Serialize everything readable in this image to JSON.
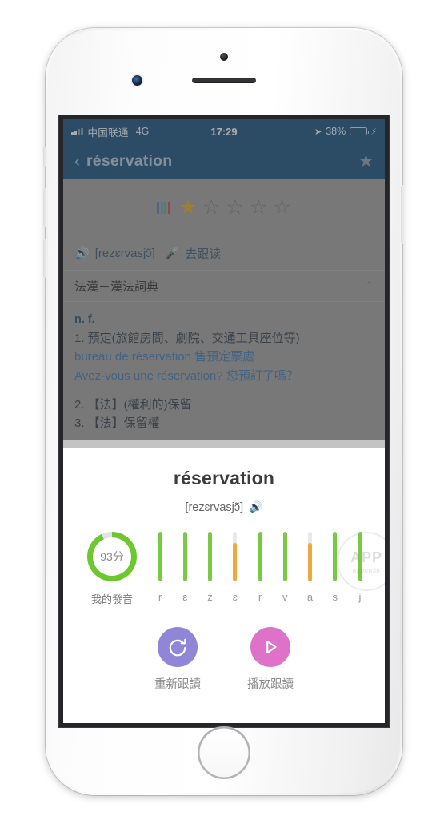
{
  "status_bar": {
    "carrier": "中国联通",
    "network": "4G",
    "time": "17:29",
    "battery_percent": "38%",
    "battery_level": 38,
    "location_icon": "location-arrow-icon",
    "charging_icon": "charging-bolt-icon"
  },
  "nav_bar": {
    "back_icon": "chevron-left-icon",
    "title": "réservation",
    "favorite_icon": "star-filled-icon"
  },
  "rating": {
    "books_icon": "books-icon",
    "stars_total": 5,
    "stars_filled": 1,
    "filled_color": "#c99524",
    "empty_color": "#6e6e6e"
  },
  "phonetic_row": {
    "speaker_icon": "speaker-icon",
    "phonetic": "[rezɛrvasjɔ̃]",
    "mic_icon": "microphone-icon",
    "follow_read_label": "去跟读"
  },
  "dictionary": {
    "title": "法漢－漢法詞典",
    "collapse_icon": "chevron-up-icon",
    "part_of_speech": "n. f.",
    "entries": [
      "1. 預定(旅館房間、劇院、交通工具座位等)",
      "2. 【法】(權利的)保留",
      "3. 【法】保留權"
    ],
    "examples": [
      "bureau de réservation 售預定票處",
      "Avez-vous une réservation? 您預訂了嗎？"
    ]
  },
  "practice_sheet": {
    "word": "réservation",
    "phonetic": "[rezɛrvasjɔ̃]",
    "speaker_icon": "speaker-icon",
    "score": {
      "value": "93分",
      "percent": 93,
      "label": "我的發音",
      "ring_color": "#6dc72e",
      "ring_track_color": "#e2e2e2"
    },
    "phonemes": [
      {
        "label": "r",
        "level": 100,
        "color": "#7ac943"
      },
      {
        "label": "ɛ",
        "level": 100,
        "color": "#7ac943"
      },
      {
        "label": "z",
        "level": 100,
        "color": "#7ac943"
      },
      {
        "label": "ɛ",
        "level": 78,
        "color": "#f0a83c"
      },
      {
        "label": "r",
        "level": 100,
        "color": "#7ac943"
      },
      {
        "label": "v",
        "level": 100,
        "color": "#7ac943"
      },
      {
        "label": "a",
        "level": 78,
        "color": "#f0a83c"
      },
      {
        "label": "s",
        "level": 100,
        "color": "#7ac943"
      },
      {
        "label": "j",
        "level": 100,
        "color": "#7ac943"
      }
    ],
    "actions": [
      {
        "label": "重新跟讀",
        "icon": "refresh-icon",
        "color": "#8f86d8"
      },
      {
        "label": "播放跟讀",
        "icon": "play-icon",
        "color": "#dd72c8"
      }
    ]
  },
  "watermark": {
    "main": "APP",
    "sub": "appun.in"
  }
}
